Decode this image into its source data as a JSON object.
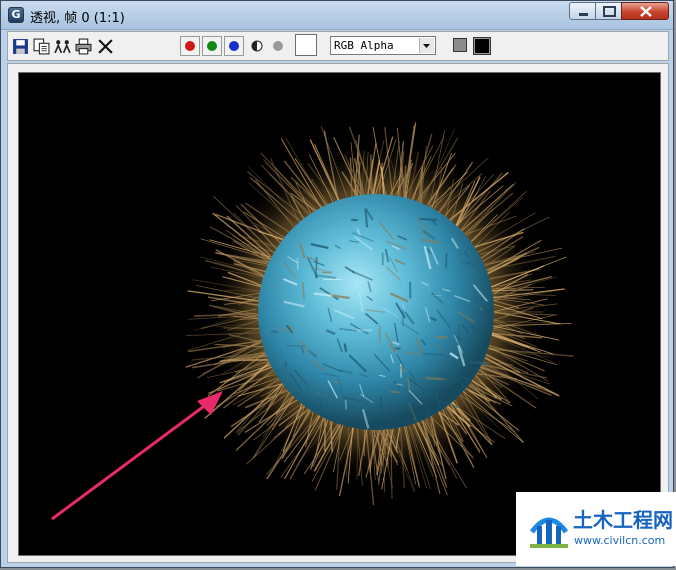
{
  "window": {
    "title": "透视, 帧 0 (1:1)"
  },
  "app_icon": {
    "glyph": "G"
  },
  "toolbar": {
    "buttons": [
      "save-icon",
      "copy-icon",
      "clone-icon",
      "print-icon",
      "clear-icon"
    ],
    "channels": [
      {
        "name": "red-channel",
        "color": "#d01818"
      },
      {
        "name": "green-channel",
        "color": "#108a10"
      },
      {
        "name": "blue-channel",
        "color": "#1830c8"
      }
    ],
    "display_channel": "RGB Alpha"
  },
  "watermark": {
    "title": "土木工程网",
    "url": "www.civilcn.com"
  }
}
